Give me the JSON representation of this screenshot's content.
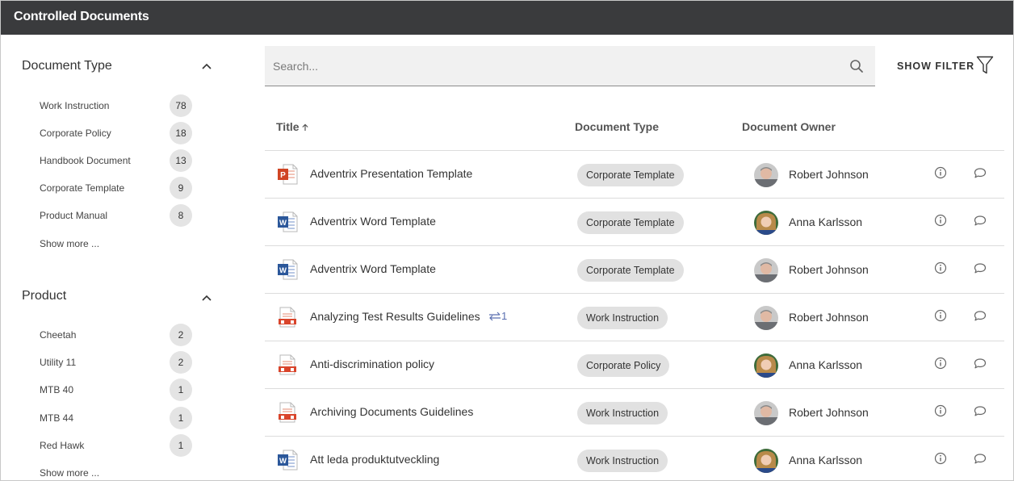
{
  "app": {
    "title": "Controlled Documents"
  },
  "facets": {
    "document_type": {
      "title": "Document Type",
      "items": [
        {
          "label": "Work Instruction",
          "count": "78"
        },
        {
          "label": "Corporate Policy",
          "count": "18"
        },
        {
          "label": "Handbook Document",
          "count": "13"
        },
        {
          "label": "Corporate Template",
          "count": "9"
        },
        {
          "label": "Product Manual",
          "count": "8"
        }
      ],
      "show_more": "Show more ..."
    },
    "product": {
      "title": "Product",
      "items": [
        {
          "label": "Cheetah",
          "count": "2"
        },
        {
          "label": "Utility 11",
          "count": "2"
        },
        {
          "label": "MTB 40",
          "count": "1"
        },
        {
          "label": "MTB 44",
          "count": "1"
        },
        {
          "label": "Red Hawk",
          "count": "1"
        }
      ],
      "show_more": "Show more ..."
    }
  },
  "search": {
    "placeholder": "Search...",
    "value": ""
  },
  "filter": {
    "label": "SHOW FILTER"
  },
  "table": {
    "columns": {
      "title": "Title",
      "type": "Document Type",
      "owner": "Document Owner"
    },
    "sort": {
      "column": "Title",
      "direction": "ascending"
    },
    "rows": [
      {
        "file_icon": "powerpoint-icon",
        "title": "Adventrix Presentation Template",
        "type": "Corporate Template",
        "owner": "Robert Johnson",
        "avatar": "male-avatar"
      },
      {
        "file_icon": "word-icon",
        "title": "Adventrix Word Template",
        "type": "Corporate Template",
        "owner": "Anna Karlsson",
        "avatar": "female-avatar"
      },
      {
        "file_icon": "word-icon",
        "title": "Adventrix Word Template",
        "type": "Corporate Template",
        "owner": "Robert Johnson",
        "avatar": "male-avatar"
      },
      {
        "file_icon": "pdf-icon",
        "title": "Analyzing Test Results Guidelines",
        "link_count": "1",
        "type": "Work Instruction",
        "owner": "Robert Johnson",
        "avatar": "male-avatar"
      },
      {
        "file_icon": "pdf-icon",
        "title": "Anti-discrimination policy",
        "type": "Corporate Policy",
        "owner": "Anna Karlsson",
        "avatar": "female-avatar"
      },
      {
        "file_icon": "pdf-icon",
        "title": "Archiving Documents Guidelines",
        "type": "Work Instruction",
        "owner": "Robert Johnson",
        "avatar": "male-avatar"
      },
      {
        "file_icon": "word-icon",
        "title": "Att leda produktutveckling",
        "type": "Work Instruction",
        "owner": "Anna Karlsson",
        "avatar": "female-avatar"
      }
    ]
  },
  "colors": {
    "titlebar": "#3a3b3d",
    "powerpoint": "#d04423",
    "word": "#2b579a",
    "pdf": "#d9442b",
    "link": "#5a6fb0"
  }
}
